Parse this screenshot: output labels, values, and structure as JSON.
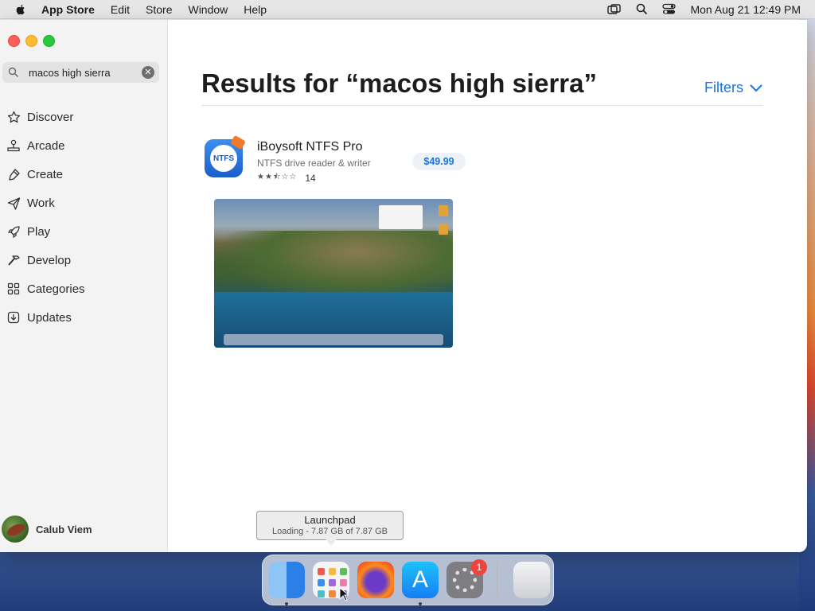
{
  "menubar": {
    "app_name": "App Store",
    "menus": [
      "Edit",
      "Store",
      "Window",
      "Help"
    ],
    "clock": "Mon Aug 21  12:49 PM"
  },
  "sidebar": {
    "search_value": "macos high sierra",
    "items": [
      {
        "label": "Discover",
        "icon": "star-icon"
      },
      {
        "label": "Arcade",
        "icon": "joystick-icon"
      },
      {
        "label": "Create",
        "icon": "brush-icon"
      },
      {
        "label": "Work",
        "icon": "paper-plane-icon"
      },
      {
        "label": "Play",
        "icon": "rocket-icon"
      },
      {
        "label": "Develop",
        "icon": "hammer-icon"
      },
      {
        "label": "Categories",
        "icon": "grid-icon"
      },
      {
        "label": "Updates",
        "icon": "download-icon"
      }
    ],
    "user_name": "Calub Viem"
  },
  "main": {
    "title": "Results for “macos high sierra”",
    "filters_label": "Filters",
    "result": {
      "name": "iBoysoft NTFS Pro",
      "subtitle": "NTFS drive reader & writer",
      "icon_text": "NTFS",
      "rating": 2.5,
      "rating_count": "14",
      "price": "$49.99"
    }
  },
  "tooltip": {
    "title": "Launchpad",
    "detail": "Loading - 7.87 GB of 7.87 GB"
  },
  "dock": {
    "items": [
      "Finder",
      "Launchpad",
      "Firefox",
      "App Store",
      "System Settings",
      "Trash"
    ],
    "settings_badge": "1"
  },
  "colors": {
    "accent": "#1a74d9",
    "close": "#fe5f57",
    "minimize": "#febc2e",
    "maximize": "#28c840",
    "badge": "#f0433a"
  }
}
